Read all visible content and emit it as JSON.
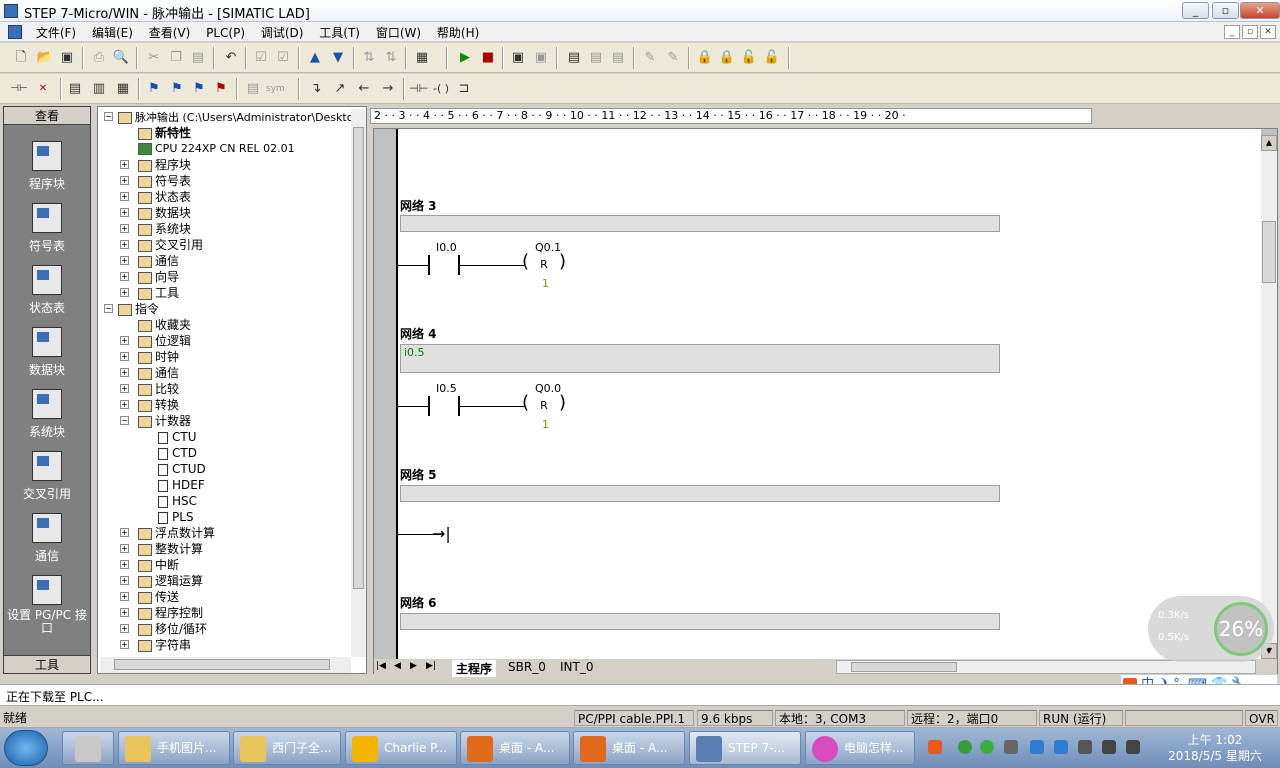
{
  "window": {
    "title": "STEP 7-Micro/WIN - 脉冲输出 - [SIMATIC LAD]"
  },
  "menu": [
    "文件(F)",
    "编辑(E)",
    "查看(V)",
    "PLC(P)",
    "调试(D)",
    "工具(T)",
    "窗口(W)",
    "帮助(H)"
  ],
  "nav": {
    "header": "查看",
    "footer": "工具",
    "items": [
      "程序块",
      "符号表",
      "状态表",
      "数据块",
      "系统块",
      "交叉引用",
      "通信",
      "设置 PG/PC 接口"
    ]
  },
  "tree": {
    "root": "脉冲输出 (C:\\Users\\Administrator\\Desktop)",
    "new_features": "新特性",
    "cpu": "CPU 224XP CN REL 02.01",
    "project_items": [
      "程序块",
      "符号表",
      "状态表",
      "数据块",
      "系统块",
      "交叉引用",
      "通信",
      "向导",
      "工具"
    ],
    "instructions": "指令",
    "instr_items": [
      "收藏夹",
      "位逻辑",
      "时钟",
      "通信",
      "比较",
      "转换",
      "计数器"
    ],
    "counter_items": [
      "CTU",
      "CTD",
      "CTUD",
      "HDEF",
      "HSC",
      "PLS"
    ],
    "instr_items_after": [
      "浮点数计算",
      "整数计算",
      "中断",
      "逻辑运算",
      "传送",
      "程序控制",
      "移位/循环",
      "字符串"
    ]
  },
  "ruler": "2 · · 3 · · 4 · · 5 · · 6 · · 7 · · 8 · · 9 · · 10 · · 11 · · 12 · · 13 · · 14 · · 15 · · 16 · · 17 · · 18 · · 19 · · 20 ·",
  "networks": [
    {
      "title": "网络 3",
      "comment": "",
      "contact": "I0.0",
      "coil": "Q0.1",
      "coil_type": "R",
      "param": "1"
    },
    {
      "title": "网络 4",
      "comment": "i0.5",
      "contact": "I0.5",
      "coil": "Q0.0",
      "coil_type": "R",
      "param": "1"
    },
    {
      "title": "网络 5",
      "comment": ""
    },
    {
      "title": "网络 6",
      "comment": ""
    }
  ],
  "tabs": [
    "主程序",
    "SBR_0",
    "INT_0"
  ],
  "status": {
    "message": "正在下载至 PLC...",
    "ready": "就绪",
    "cable": "PC/PPI cable.PPI.1",
    "baud": "9.6 kbps",
    "local": "本地：3, COM3",
    "remote": "远程：2，端口0",
    "mode": "RUN (运行)",
    "ovr": "OVR"
  },
  "netmon": {
    "up": "0.3K/s",
    "down": "0.5K/s",
    "percent": "26%"
  },
  "ime": "中 ❩ °, ⌨ 👕 🔧",
  "taskbar": {
    "tasks": [
      "手机图片...",
      "西门子全...",
      "Charlie P...",
      "桌面 - A...",
      "桌面 - A...",
      "STEP 7-...",
      "电脑怎样..."
    ],
    "time": "上午 1:02",
    "date": "2018/5/5 星期六"
  }
}
